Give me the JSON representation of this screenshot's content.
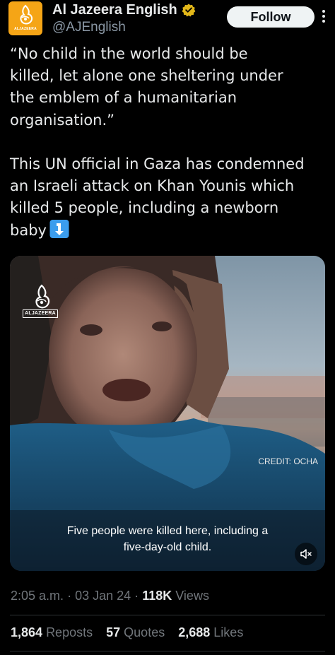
{
  "author": {
    "display_name": "Al Jazeera English",
    "handle": "@AJEnglish",
    "avatar_text": "ALJAZEERA",
    "verified": true
  },
  "follow_label": "Follow",
  "tweet": {
    "text": "“No child in the world should be\nkilled, let alone one sheltering under\nthe emblem of a humanitarian\norganisation.”\n\nThis UN official in Gaza has condemned\nan Israeli attack on Khan Younis which\nkilled 5 people, including a newborn\nbaby",
    "emoji": "arrow-down-icon"
  },
  "video": {
    "logo_text": "ALJAZEERA",
    "credit": "CREDIT: OCHA",
    "subtitle": "Five people were killed here, including a\nfive-day-old child.",
    "muted": true
  },
  "meta": {
    "time": "2:05 a.m.",
    "date": "03 Jan 24",
    "views_count": "118K",
    "views_label": "Views",
    "separator": "·"
  },
  "stats": {
    "reposts_count": "1,864",
    "reposts_label": "Reposts",
    "quotes_count": "57",
    "quotes_label": "Quotes",
    "likes_count": "2,688",
    "likes_label": "Likes"
  },
  "colors": {
    "background": "#000000",
    "text": "#e7e9ea",
    "secondary_text": "#71767b",
    "avatar": "#f5a516",
    "verified_badge": "#e2b719",
    "follow_button": "#eff3f4"
  }
}
